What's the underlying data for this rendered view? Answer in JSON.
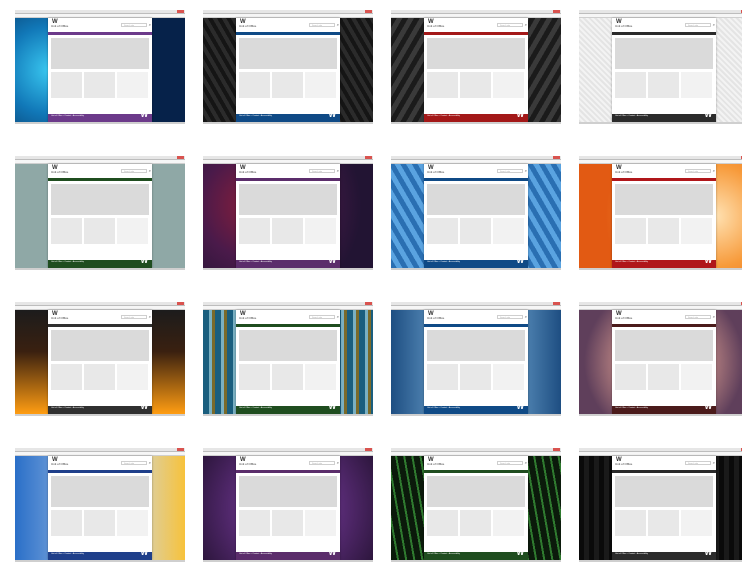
{
  "thumbnails": [
    {
      "site_title": "Unit of Office",
      "theme": "#6c3a8a",
      "bg": "bg-blue-hex",
      "col": 0,
      "row": 0
    },
    {
      "site_title": "Unit of Office",
      "theme": "#0f4a86",
      "bg": "bg-dark-hex",
      "col": 1,
      "row": 0
    },
    {
      "site_title": "Unit of Office",
      "theme": "#a31818",
      "bg": "bg-gray-hex",
      "col": 2,
      "row": 0
    },
    {
      "site_title": "Unit of Office",
      "theme": "#2b2b2b",
      "bg": "bg-light-tex",
      "col": 3,
      "row": 0
    },
    {
      "site_title": "Unit of Office",
      "theme": "#1f4d1f",
      "bg": "bg-teal",
      "col": 0,
      "row": 1
    },
    {
      "site_title": "Unit of Office",
      "theme": "#5b2d6b",
      "bg": "bg-plum",
      "col": 1,
      "row": 1
    },
    {
      "site_title": "Unit of Office",
      "theme": "#0f4a86",
      "bg": "bg-blue-cells",
      "col": 2,
      "row": 1
    },
    {
      "site_title": "Unit of Office",
      "theme": "#b0161a",
      "bg": "bg-orange",
      "col": 3,
      "row": 1
    },
    {
      "site_title": "Unit of Office",
      "theme": "#303030",
      "bg": "bg-dark-orange",
      "col": 0,
      "row": 2
    },
    {
      "site_title": "Unit of Office",
      "theme": "#1f4d1f",
      "bg": "bg-teal-gold",
      "col": 1,
      "row": 2
    },
    {
      "site_title": "Unit of Office",
      "theme": "#0f4a86",
      "bg": "bg-ice",
      "col": 2,
      "row": 2
    },
    {
      "site_title": "Unit of Office",
      "theme": "#4b1b1b",
      "bg": "bg-petals",
      "col": 3,
      "row": 2
    },
    {
      "site_title": "Unit of Office",
      "theme": "#1f3f8a",
      "bg": "bg-blue-yellow",
      "col": 0,
      "row": 3
    },
    {
      "site_title": "Unit of Office",
      "theme": "#5b2d6b",
      "bg": "bg-purple",
      "col": 1,
      "row": 3
    },
    {
      "site_title": "Unit of Office",
      "theme": "#1f4d1f",
      "bg": "bg-green",
      "col": 2,
      "row": 3
    },
    {
      "site_title": "Unit of Office",
      "theme": "#2b2b2b",
      "bg": "bg-black",
      "col": 3,
      "row": 3
    }
  ],
  "search": {
    "placeholder": "Search site"
  },
  "footer": {
    "text": "Unit of Office • Contact • Accessibility"
  }
}
